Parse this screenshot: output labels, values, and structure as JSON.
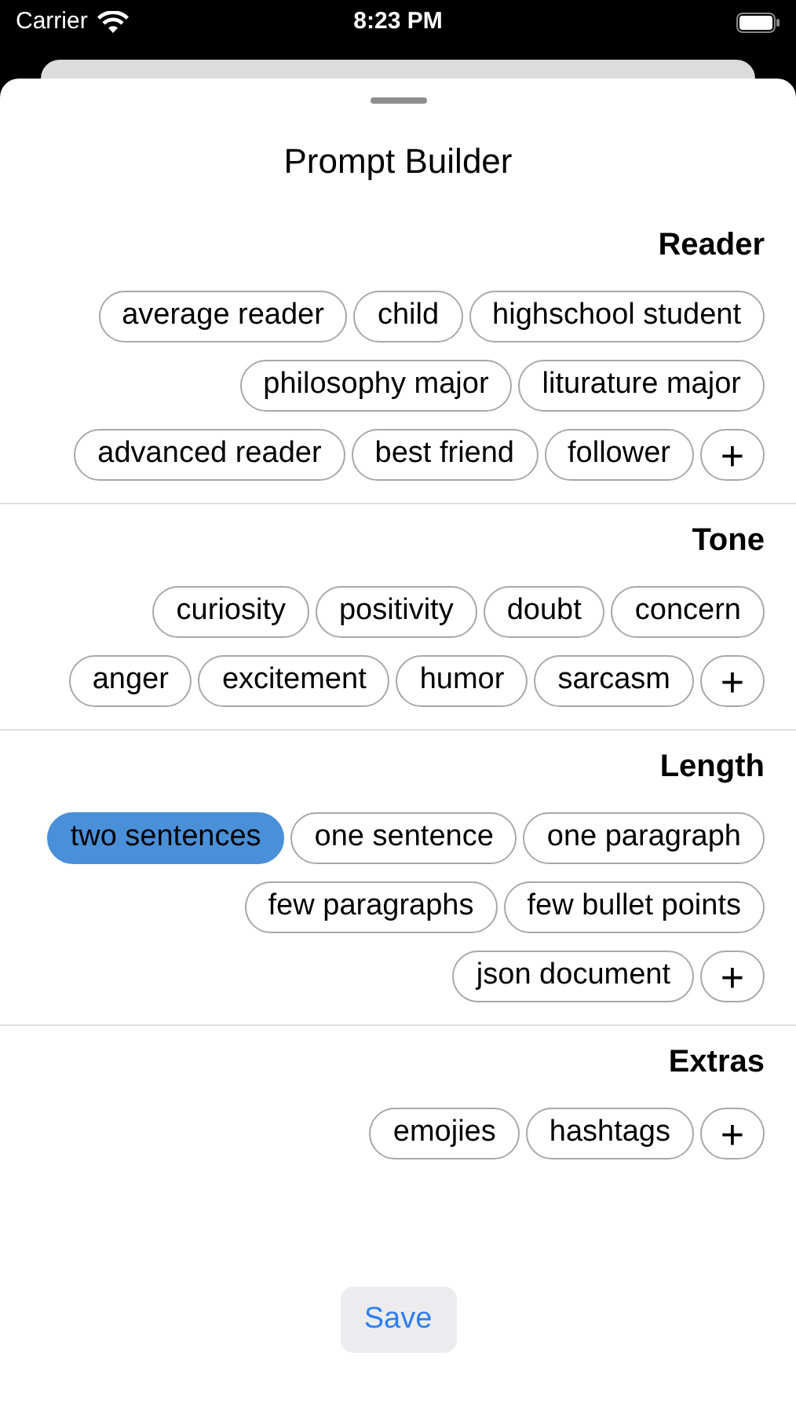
{
  "status_bar": {
    "carrier": "Carrier",
    "time": "8:23 PM"
  },
  "title": "Prompt Builder",
  "sections": [
    {
      "title": "Reader",
      "add": "+",
      "chips": [
        {
          "label": "average reader",
          "selected": false
        },
        {
          "label": "child",
          "selected": false
        },
        {
          "label": "highschool student",
          "selected": false
        },
        {
          "label": "philosophy major",
          "selected": false
        },
        {
          "label": "liturature major",
          "selected": false
        },
        {
          "label": "advanced reader",
          "selected": false
        },
        {
          "label": "best friend",
          "selected": false
        },
        {
          "label": "follower",
          "selected": false
        }
      ]
    },
    {
      "title": "Tone",
      "add": "+",
      "chips": [
        {
          "label": "curiosity",
          "selected": false
        },
        {
          "label": "positivity",
          "selected": false
        },
        {
          "label": "doubt",
          "selected": false
        },
        {
          "label": "concern",
          "selected": false
        },
        {
          "label": "anger",
          "selected": false
        },
        {
          "label": "excitement",
          "selected": false
        },
        {
          "label": "humor",
          "selected": false
        },
        {
          "label": "sarcasm",
          "selected": false
        }
      ]
    },
    {
      "title": "Length",
      "add": "+",
      "chips": [
        {
          "label": "two sentences",
          "selected": true
        },
        {
          "label": "one sentence",
          "selected": false
        },
        {
          "label": "one paragraph",
          "selected": false
        },
        {
          "label": "few paragraphs",
          "selected": false
        },
        {
          "label": "few bullet points",
          "selected": false
        },
        {
          "label": "json document",
          "selected": false
        }
      ]
    },
    {
      "title": "Extras",
      "add": "+",
      "chips": [
        {
          "label": "emojies",
          "selected": false
        },
        {
          "label": "hashtags",
          "selected": false
        }
      ]
    }
  ],
  "save": "Save"
}
